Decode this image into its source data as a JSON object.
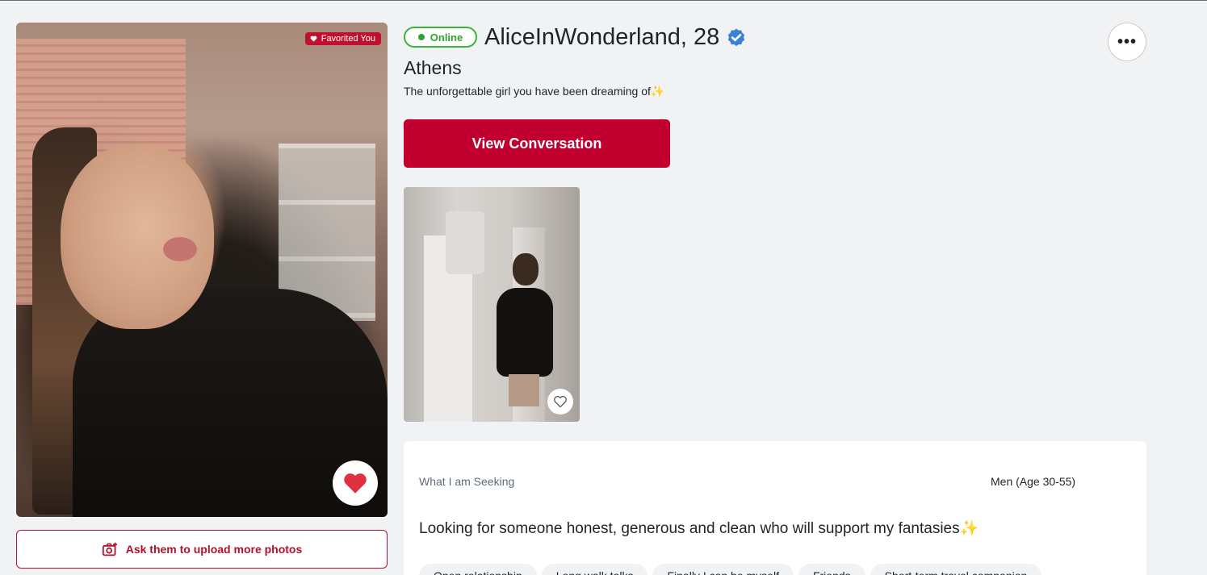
{
  "profile": {
    "favorited_badge": "Favorited You",
    "status": "Online",
    "name": "AliceInWonderland, 28",
    "city": "Athens",
    "tagline": "The unforgettable girl you have been dreaming of✨"
  },
  "actions": {
    "view_conversation": "View Conversation",
    "ask_photos": "Ask them to upload more photos",
    "more": "•••"
  },
  "seeking": {
    "label": "What I am Seeking",
    "target": "Men (Age 30-55)",
    "description": "Looking for someone honest, generous and clean who will support my fantasies✨",
    "tags": [
      "Open relationship",
      "Long walk talks",
      "Finally I can be myself",
      "Friends",
      "Short-term travel companion"
    ]
  },
  "colors": {
    "brand": "#c1002f",
    "online": "#2fa52f",
    "verified": "#3b82d6",
    "like": "#e0303f"
  },
  "icons": {
    "favorite": "heart-icon",
    "verified": "verified-badge-icon",
    "more": "ellipsis-icon",
    "ask": "camera-plus-icon",
    "thumb_like": "heart-outline-icon"
  }
}
